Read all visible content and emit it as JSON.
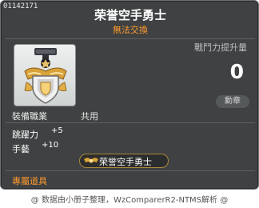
{
  "item": {
    "id": "01142171",
    "name": "荣誉空手勇士",
    "trade_status": "無法交換"
  },
  "stat": {
    "label": "戰鬥力提升量",
    "value": "0",
    "medal_button": "勳章"
  },
  "requirements": {
    "job_label": "裝備職業",
    "job_value": "共用"
  },
  "bonuses": [
    {
      "label": "跳躍力",
      "value": "+5"
    },
    {
      "label": "手藝",
      "value": "+10"
    }
  ],
  "medal_tag": {
    "text": "荣誉空手勇士",
    "icon": "wing-medal-icon"
  },
  "exclusive_label": "專屬道具",
  "footer": "@ 数据由小册子整理，WzComparerR2-NTMS解析 @",
  "colors": {
    "panel_bg": "#3f4142",
    "orange": "#ff9a2e",
    "white": "#ffffff",
    "gold": "#c9a24a"
  }
}
